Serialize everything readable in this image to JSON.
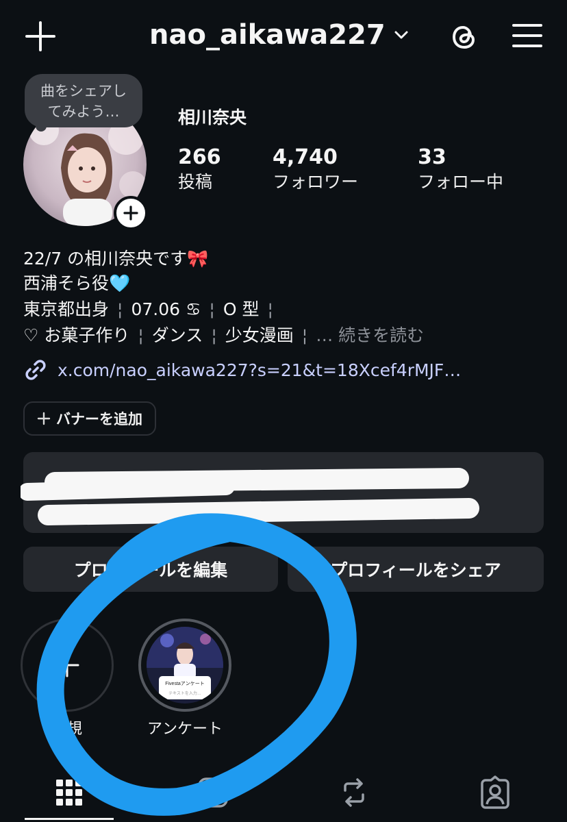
{
  "header": {
    "username": "nao_aikawa227"
  },
  "profile": {
    "note_placeholder": "曲をシェアしてみよう…",
    "note_line1": "曲をシェアし",
    "note_line2": "てみよう…",
    "display_name": "相川奈央",
    "stats": [
      {
        "value": "266",
        "label": "投稿"
      },
      {
        "value": "4,740",
        "label": "フォロワー"
      },
      {
        "value": "33",
        "label": "フォロー中"
      }
    ]
  },
  "bio": {
    "line1": "22/7 の相川奈央です🎀",
    "line2": "西浦そら役🩵",
    "line3_parts": [
      "東京都出身",
      "07.06 ♋",
      "O 型"
    ],
    "line4_parts": [
      "♡ お菓子作り",
      "ダンス",
      "少女漫画"
    ],
    "more": "… 続きを読む",
    "link": "x.com/nao_aikawa227?s=21&t=18Xcef4rMJF…"
  },
  "actions": {
    "add_banner": "バナーを追加",
    "edit_profile": "プロフィールを編集",
    "share_profile": "プロフィールをシェア"
  },
  "highlights": [
    {
      "label": "新規"
    },
    {
      "label": "アンケート",
      "thumb_caption": "Fivestaアンケート",
      "thumb_input": "テキストを入力…"
    }
  ],
  "colors": {
    "background": "#0c1014",
    "card": "#25282d",
    "link": "#c9d0ff",
    "annotation_blue": "#1f9bf0"
  },
  "icons": {
    "top_left": "plus-icon",
    "threads": "threads-icon",
    "menu": "hamburger-icon",
    "tabs": [
      "grid-icon",
      "reels-icon",
      "repost-icon",
      "tagged-icon"
    ]
  }
}
